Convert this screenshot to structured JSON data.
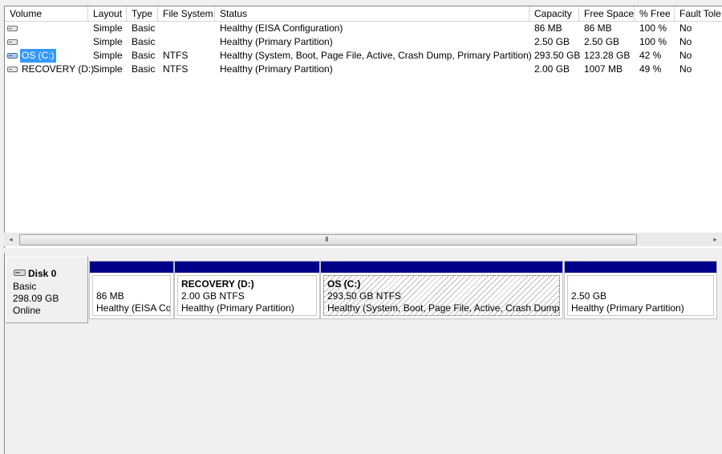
{
  "columns": [
    "Volume",
    "Layout",
    "Type",
    "File System",
    "Status",
    "Capacity",
    "Free Space",
    "% Free",
    "Fault Tole"
  ],
  "volumes": [
    {
      "volume": "",
      "layout": "Simple",
      "type": "Basic",
      "fs": "",
      "status": "Healthy (EISA Configuration)",
      "capacity": "86 MB",
      "free": "86 MB",
      "pct": "100 %",
      "fault": "No",
      "icon": "drive-icon",
      "selected": false
    },
    {
      "volume": "",
      "layout": "Simple",
      "type": "Basic",
      "fs": "",
      "status": "Healthy (Primary Partition)",
      "capacity": "2.50 GB",
      "free": "2.50 GB",
      "pct": "100 %",
      "fault": "No",
      "icon": "drive-icon",
      "selected": false
    },
    {
      "volume": "OS (C:)",
      "layout": "Simple",
      "type": "Basic",
      "fs": "NTFS",
      "status": "Healthy (System, Boot, Page File, Active, Crash Dump, Primary Partition)",
      "capacity": "293.50 GB",
      "free": "123.28 GB",
      "pct": "42 %",
      "fault": "No",
      "icon": "system-drive-icon",
      "selected": true
    },
    {
      "volume": "RECOVERY (D:)",
      "layout": "Simple",
      "type": "Basic",
      "fs": "NTFS",
      "status": "Healthy (Primary Partition)",
      "capacity": "2.00 GB",
      "free": "1007 MB",
      "pct": "49 %",
      "fault": "No",
      "icon": "drive-icon",
      "selected": false
    }
  ],
  "scrollbar": {
    "left_arrow": "◂",
    "right_arrow": "▸",
    "grip": "III"
  },
  "disk": {
    "name": "Disk 0",
    "type": "Basic",
    "size": "298.09 GB",
    "status": "Online"
  },
  "partitions": [
    {
      "title": "",
      "size": "86 MB",
      "status": "Healthy (EISA Configuration)",
      "hatched": false
    },
    {
      "title": "RECOVERY  (D:)",
      "size": "2.00 GB NTFS",
      "status": "Healthy (Primary Partition)",
      "hatched": false
    },
    {
      "title": "OS  (C:)",
      "size": "293.50 GB NTFS",
      "status": "Healthy (System, Boot, Page File, Active, Crash Dump, Primary Partition)",
      "hatched": true
    },
    {
      "title": "",
      "size": "2.50 GB",
      "status": "Healthy (Primary Partition)",
      "hatched": false
    }
  ],
  "colors": {
    "partition_bar": "#00008b",
    "selection": "#3399ff",
    "background": "#f0f0f0"
  }
}
